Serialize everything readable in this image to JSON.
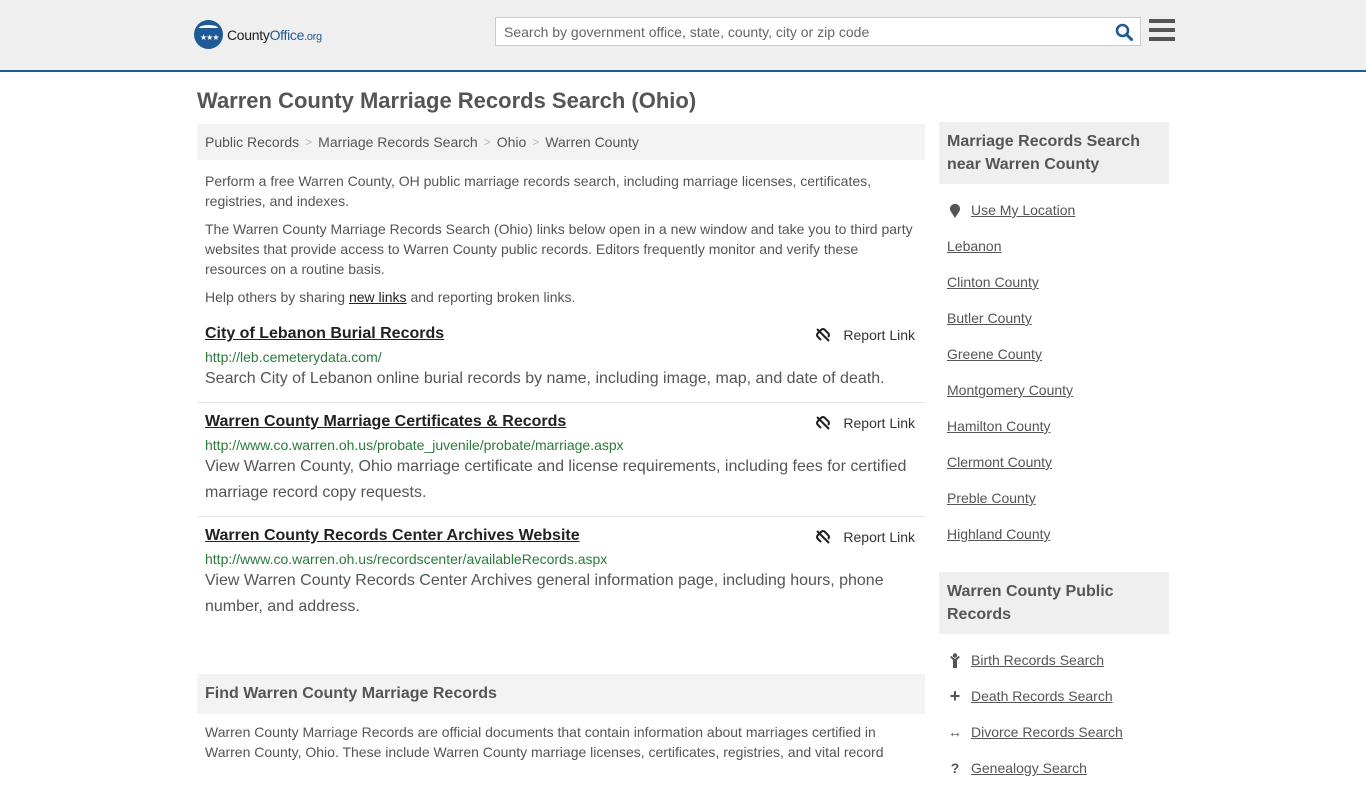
{
  "header": {
    "logo": {
      "text_main": "County",
      "text_brand": "Office",
      "text_tld": ".org"
    },
    "search_placeholder": "Search by government office, state, county, city or zip code",
    "search_value": ""
  },
  "page_title": "Warren County Marriage Records Search (Ohio)",
  "breadcrumb": [
    "Public Records",
    "Marriage Records Search",
    "Ohio",
    "Warren County"
  ],
  "breadcrumb_sep": ">",
  "intro": {
    "p1": "Perform a free Warren County, OH public marriage records search, including marriage licenses, certificates, registries, and indexes.",
    "p2": "The Warren County Marriage Records Search (Ohio) links below open in a new window and take you to third party websites that provide access to Warren County public records. Editors frequently monitor and verify these resources on a routine basis.",
    "p3_before": "Help others by sharing ",
    "p3_link": "new links",
    "p3_after": " and reporting broken links."
  },
  "report_label": "Report Link",
  "entries": [
    {
      "title": "City of Lebanon Burial Records",
      "url": "http://leb.cemeterydata.com/",
      "desc": "Search City of Lebanon online burial records by name, including image, map, and date of death."
    },
    {
      "title": "Warren County Marriage Certificates & Records",
      "url": "http://www.co.warren.oh.us/probate_juvenile/probate/marriage.aspx",
      "desc": "View Warren County, Ohio marriage certificate and license requirements, including fees for certified marriage record copy requests."
    },
    {
      "title": "Warren County Records Center Archives Website",
      "url": "http://www.co.warren.oh.us/recordscenter/availableRecords.aspx",
      "desc": "View Warren County Records Center Archives general information page, including hours, phone number, and address."
    }
  ],
  "find": {
    "title": "Find Warren County Marriage Records",
    "text": "Warren County Marriage Records are official documents that contain information about marriages certified in Warren County, Ohio. These include Warren County marriage licenses, certificates, registries, and vital record"
  },
  "sidebar": {
    "nearby_title": "Marriage Records Search near Warren County",
    "use_location": "Use My Location",
    "nearby": [
      "Lebanon",
      "Clinton County",
      "Butler County",
      "Greene County",
      "Montgomery County",
      "Hamilton County",
      "Clermont County",
      "Preble County",
      "Highland County"
    ],
    "public_title": "Warren County Public Records",
    "public": [
      {
        "icon": "person-icon",
        "glyph": "Ὣ9",
        "label": "Birth Records Search"
      },
      {
        "icon": "cross-icon",
        "glyph": "+",
        "label": "Death Records Search"
      },
      {
        "icon": "arrows-horizontal-icon",
        "glyph": "↔",
        "label": "Divorce Records Search"
      },
      {
        "icon": "question-icon",
        "glyph": "?",
        "label": "Genealogy Search"
      }
    ]
  },
  "colors": {
    "brand": "#1f5a96",
    "url_green": "#2a7a3b",
    "panel_bg": "#f3f3f3"
  }
}
